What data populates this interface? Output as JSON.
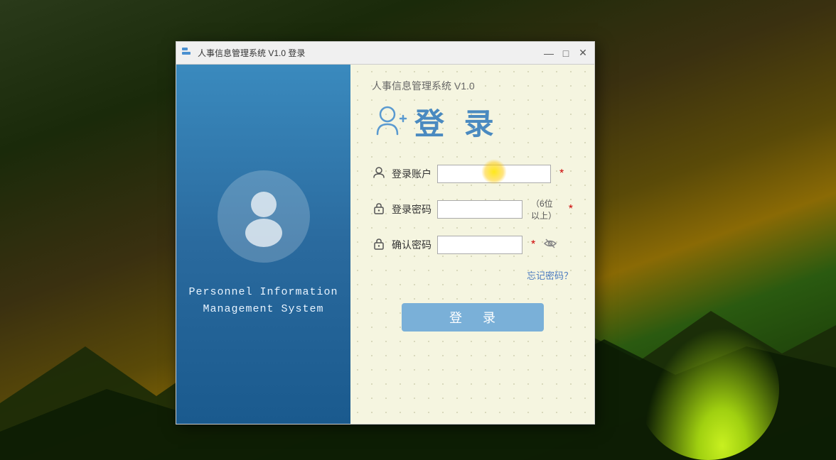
{
  "background": {
    "description": "dark nature scene with mountains and tent"
  },
  "window": {
    "title": "人事信息管理系统 V1.0  登录",
    "controls": {
      "minimize": "—",
      "maximize": "□",
      "close": "✕"
    }
  },
  "left_panel": {
    "system_name_line1": "Personnel Information",
    "system_name_line2": "Management System"
  },
  "right_panel": {
    "app_title": "人事信息管理系统 V1.0",
    "login_title": "登 录",
    "form": {
      "username": {
        "label": "登录账户",
        "placeholder": "",
        "required_star": "*"
      },
      "password": {
        "label": "登录密码",
        "placeholder": "",
        "hint": "（6位以上）",
        "required_star": "*"
      },
      "confirm_password": {
        "label": "确认密码",
        "placeholder": "",
        "required_star": "*"
      }
    },
    "forgot_password": "忘记密码？",
    "login_button": "登  录"
  }
}
